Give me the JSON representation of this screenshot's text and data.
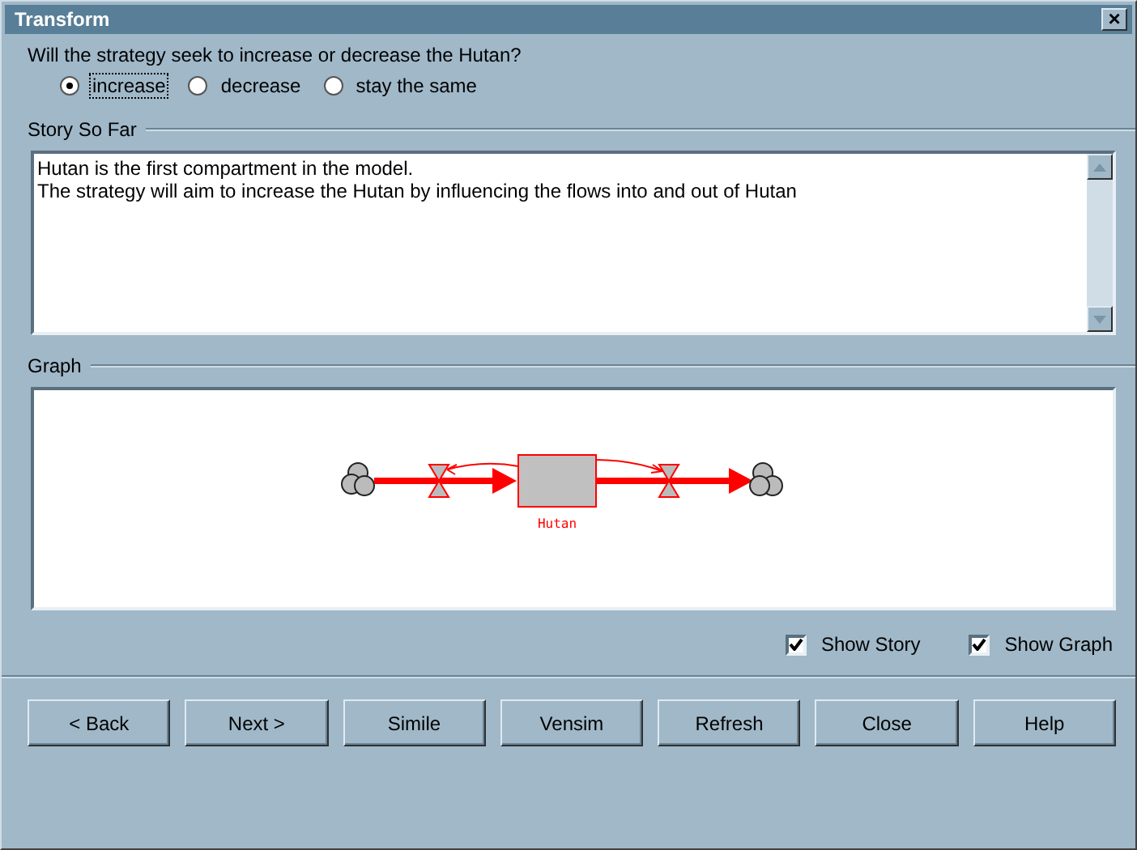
{
  "window": {
    "title": "Transform",
    "close": "×"
  },
  "question": "Will the strategy seek to increase or decrease the Hutan?",
  "options": [
    {
      "label": "increase",
      "selected": true
    },
    {
      "label": "decrease",
      "selected": false
    },
    {
      "label": "stay the same",
      "selected": false
    }
  ],
  "story": {
    "heading": "Story So Far",
    "lines": [
      "Hutan is the first compartment in the model.",
      "The strategy will aim to increase the Hutan by influencing the flows into and out of Hutan"
    ]
  },
  "graph": {
    "heading": "Graph",
    "stock_label": "Hutan"
  },
  "toggles": [
    {
      "label": "Show Story",
      "checked": true
    },
    {
      "label": "Show Graph",
      "checked": true
    }
  ],
  "buttons": [
    "< Back",
    "Next >",
    "Simile",
    "Vensim",
    "Refresh",
    "Close",
    "Help"
  ]
}
